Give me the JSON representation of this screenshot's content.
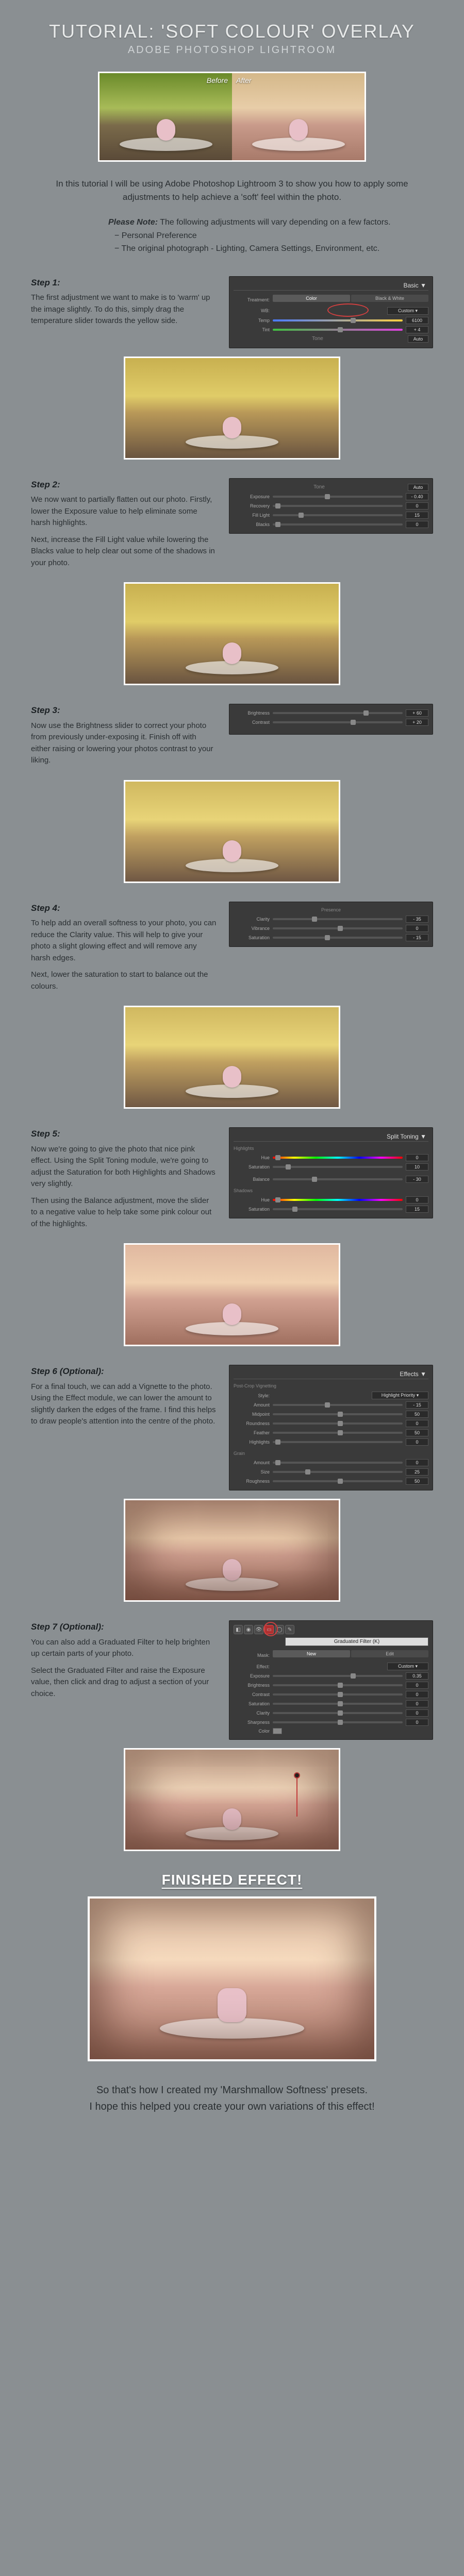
{
  "header": {
    "title": "TUTORIAL: 'SOFT COLOUR' OVERLAY",
    "subtitle": "ADOBE PHOTOSHOP LIGHTROOM"
  },
  "compare": {
    "before": "Before",
    "after": "After"
  },
  "intro": "In this tutorial I will be using Adobe Photoshop Lightroom 3 to show you how to apply some adjustments to help achieve a 'soft' feel within the photo.",
  "note": {
    "lead": "Please Note:",
    "text": " The following adjustments will vary depending on a few factors.",
    "b1": "− Personal Preference",
    "b2": "− The original photograph - Lighting, Camera Settings, Environment, etc."
  },
  "steps": [
    {
      "h": "Step 1:",
      "p1": "The first adjustment we want to make is to 'warm' up the image slightly. To do this, simply drag the temperature slider towards the yellow side."
    },
    {
      "h": "Step 2:",
      "p1": "We now want to partially flatten out our photo. Firstly, lower the Exposure value to help eliminate some harsh highlights.",
      "p2": "Next, increase the Fill Light value while lowering the Blacks value to help clear out some of the shadows in your photo."
    },
    {
      "h": "Step 3:",
      "p1": "Now use the Brightness slider to correct your photo from previously under-exposing it. Finish off with either raising or lowering your photos contrast to your liking."
    },
    {
      "h": "Step 4:",
      "p1": "To help add an overall softness to your photo, you can reduce the Clarity value. This will help to give your photo a slight glowing effect and will remove any harsh edges.",
      "p2": "Next, lower the saturation to start to balance out the colours."
    },
    {
      "h": "Step 5:",
      "p1": "Now we're going to give the photo that nice pink effect. Using the Split Toning module, we're going to adjust the Saturation for both Highlights and Shadows very slightly.",
      "p2": "Then using the Balance adjustment, move the slider to a negative value to help take some pink colour out of the highlights."
    },
    {
      "h": "Step 6 (Optional):",
      "p1": "For a final touch, we can add a Vignette to the photo. Using the Effect module, we can lower the amount to slightly darken the edges of the frame. I find this helps to draw people's attention into the centre of the photo."
    },
    {
      "h": "Step 7 (Optional):",
      "p1": "You can also add a Graduated Filter to help brighten up certain parts of your photo.",
      "p2": "Select the Graduated Filter and raise the Exposure value, then click and drag to adjust a section of your choice."
    }
  ],
  "panels": {
    "basic": {
      "title": "Basic ▼",
      "treatment": "Treatment:",
      "color": "Color",
      "bw": "Black & White",
      "wb": "WB:",
      "custom": "Custom ▾",
      "temp": "Temp",
      "tempv": "6100",
      "tint": "Tint",
      "tintv": "+ 4",
      "auto": "Auto",
      "tone": "Tone"
    },
    "exp": {
      "exposure": "Exposure",
      "exposurev": "- 0.40",
      "recovery": "Recovery",
      "recoveryv": "0",
      "fill": "Fill Light",
      "fillv": "15",
      "blacks": "Blacks",
      "blacksv": "0"
    },
    "bc": {
      "brightness": "Brightness",
      "brightnessv": "+ 60",
      "contrast": "Contrast",
      "contrastv": "+ 20"
    },
    "presence": {
      "title": "Presence",
      "clarity": "Clarity",
      "clarityv": "- 35",
      "vibrance": "Vibrance",
      "vibrancev": "0",
      "saturation": "Saturation",
      "saturationv": "- 15"
    },
    "split": {
      "title": "Split Toning ▼",
      "highlights": "Highlights",
      "hue": "Hue",
      "huehv": "0",
      "sat": "Saturation",
      "sathv": "10",
      "balance": "Balance",
      "balancev": "- 30",
      "shadows": "Shadows",
      "huesv": "0",
      "satsv": "15"
    },
    "effects": {
      "title": "Effects ▼",
      "sub1": "Post-Crop Vignetting",
      "style": "Style:",
      "stylev": "Highlight Priority ▾",
      "amount": "Amount",
      "amountv": "- 15",
      "midpoint": "Midpoint",
      "midpointv": "50",
      "roundness": "Roundness",
      "roundnessv": "0",
      "feather": "Feather",
      "featherv": "50",
      "hl": "Highlights",
      "hlv": "0",
      "sub2": "Grain",
      "gamount": "Amount",
      "gamountv": "0",
      "gsize": "Size",
      "gsizev": "25",
      "grough": "Roughness",
      "groughv": "50"
    },
    "grad": {
      "mask": "Mask:",
      "new": "New",
      "edit": "Edit",
      "dd": "Graduated Filter (K)",
      "effect": "Effect:",
      "custom": "Custom ▾",
      "exposure": "Exposure",
      "exposurev": "0.35",
      "brightness": "Brightness",
      "brightnessv": "0",
      "contrast": "Contrast",
      "contrastv": "0",
      "saturation": "Saturation",
      "saturationv": "0",
      "clarity": "Clarity",
      "clarityv": "0",
      "sharpness": "Sharpness",
      "sharpnessv": "0",
      "color": "Color"
    }
  },
  "finished": "FINISHED EFFECT!",
  "outro1": "So that's how I created my 'Marshmallow Softness' presets.",
  "outro2": "I hope this helped you create your own variations of this effect!"
}
